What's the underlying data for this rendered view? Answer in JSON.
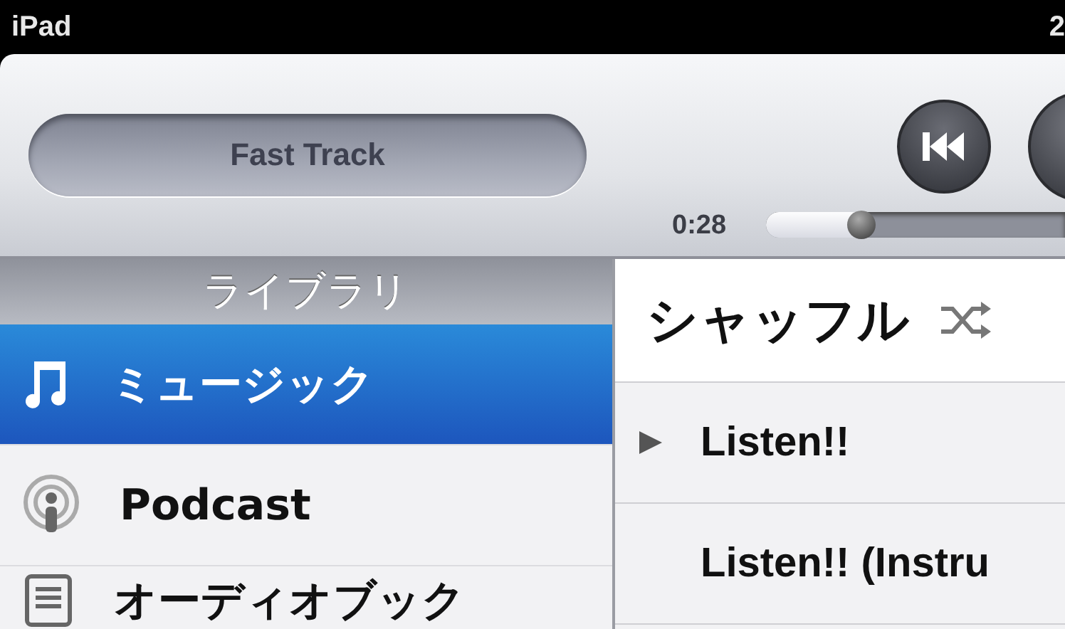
{
  "status_bar": {
    "device": "iPad",
    "time": "2"
  },
  "now_playing": {
    "title": "Fast Track",
    "elapsed": "0:28"
  },
  "sidebar": {
    "header": "ライブラリ",
    "items": [
      {
        "label": "ミュージック",
        "kind": "music",
        "selected": true
      },
      {
        "label": "Podcast",
        "kind": "podcast",
        "selected": false
      },
      {
        "label": "オーディオブック",
        "kind": "audiobook",
        "selected": false
      }
    ]
  },
  "list": {
    "shuffle": "シャッフル",
    "songs": [
      {
        "title": "Listen!!",
        "playing": true
      },
      {
        "title": "Listen!! (Instru",
        "playing": false
      }
    ]
  }
}
